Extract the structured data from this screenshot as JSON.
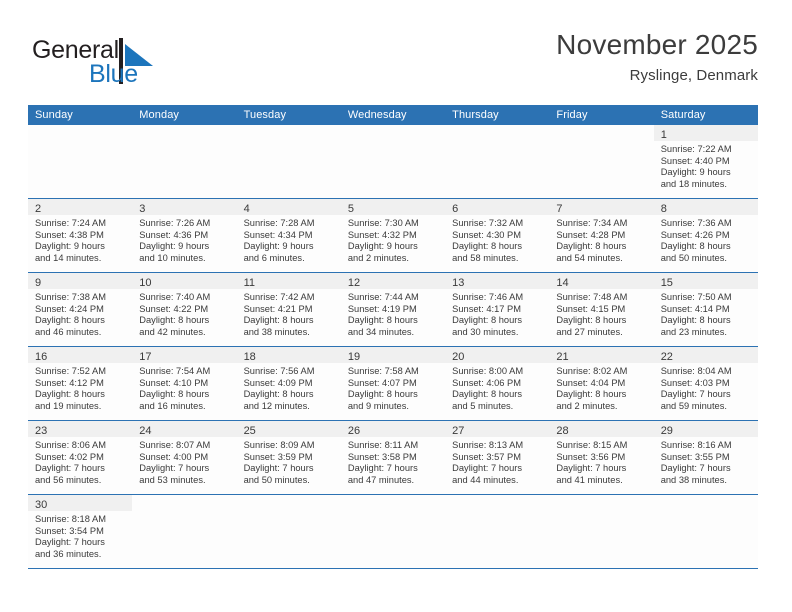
{
  "logo": {
    "word_one": "General",
    "word_two": "Blue",
    "mark": "triangle-mark",
    "color_dark": "#231f20",
    "color_blue": "#1c75bc"
  },
  "header": {
    "title": "November 2025",
    "subtitle": "Ryslinge, Denmark"
  },
  "theme": {
    "header_blue": "#2c72b3",
    "daynum_band": "#f0f0f0",
    "text": "#3a3a3a"
  },
  "weekdays": [
    "Sunday",
    "Monday",
    "Tuesday",
    "Wednesday",
    "Thursday",
    "Friday",
    "Saturday"
  ],
  "weeks": [
    [
      {
        "day": "",
        "lines": []
      },
      {
        "day": "",
        "lines": []
      },
      {
        "day": "",
        "lines": []
      },
      {
        "day": "",
        "lines": []
      },
      {
        "day": "",
        "lines": []
      },
      {
        "day": "",
        "lines": []
      },
      {
        "day": "1",
        "lines": [
          "Sunrise: 7:22 AM",
          "Sunset: 4:40 PM",
          "Daylight: 9 hours",
          "and 18 minutes."
        ]
      }
    ],
    [
      {
        "day": "2",
        "lines": [
          "Sunrise: 7:24 AM",
          "Sunset: 4:38 PM",
          "Daylight: 9 hours",
          "and 14 minutes."
        ]
      },
      {
        "day": "3",
        "lines": [
          "Sunrise: 7:26 AM",
          "Sunset: 4:36 PM",
          "Daylight: 9 hours",
          "and 10 minutes."
        ]
      },
      {
        "day": "4",
        "lines": [
          "Sunrise: 7:28 AM",
          "Sunset: 4:34 PM",
          "Daylight: 9 hours",
          "and 6 minutes."
        ]
      },
      {
        "day": "5",
        "lines": [
          "Sunrise: 7:30 AM",
          "Sunset: 4:32 PM",
          "Daylight: 9 hours",
          "and 2 minutes."
        ]
      },
      {
        "day": "6",
        "lines": [
          "Sunrise: 7:32 AM",
          "Sunset: 4:30 PM",
          "Daylight: 8 hours",
          "and 58 minutes."
        ]
      },
      {
        "day": "7",
        "lines": [
          "Sunrise: 7:34 AM",
          "Sunset: 4:28 PM",
          "Daylight: 8 hours",
          "and 54 minutes."
        ]
      },
      {
        "day": "8",
        "lines": [
          "Sunrise: 7:36 AM",
          "Sunset: 4:26 PM",
          "Daylight: 8 hours",
          "and 50 minutes."
        ]
      }
    ],
    [
      {
        "day": "9",
        "lines": [
          "Sunrise: 7:38 AM",
          "Sunset: 4:24 PM",
          "Daylight: 8 hours",
          "and 46 minutes."
        ]
      },
      {
        "day": "10",
        "lines": [
          "Sunrise: 7:40 AM",
          "Sunset: 4:22 PM",
          "Daylight: 8 hours",
          "and 42 minutes."
        ]
      },
      {
        "day": "11",
        "lines": [
          "Sunrise: 7:42 AM",
          "Sunset: 4:21 PM",
          "Daylight: 8 hours",
          "and 38 minutes."
        ]
      },
      {
        "day": "12",
        "lines": [
          "Sunrise: 7:44 AM",
          "Sunset: 4:19 PM",
          "Daylight: 8 hours",
          "and 34 minutes."
        ]
      },
      {
        "day": "13",
        "lines": [
          "Sunrise: 7:46 AM",
          "Sunset: 4:17 PM",
          "Daylight: 8 hours",
          "and 30 minutes."
        ]
      },
      {
        "day": "14",
        "lines": [
          "Sunrise: 7:48 AM",
          "Sunset: 4:15 PM",
          "Daylight: 8 hours",
          "and 27 minutes."
        ]
      },
      {
        "day": "15",
        "lines": [
          "Sunrise: 7:50 AM",
          "Sunset: 4:14 PM",
          "Daylight: 8 hours",
          "and 23 minutes."
        ]
      }
    ],
    [
      {
        "day": "16",
        "lines": [
          "Sunrise: 7:52 AM",
          "Sunset: 4:12 PM",
          "Daylight: 8 hours",
          "and 19 minutes."
        ]
      },
      {
        "day": "17",
        "lines": [
          "Sunrise: 7:54 AM",
          "Sunset: 4:10 PM",
          "Daylight: 8 hours",
          "and 16 minutes."
        ]
      },
      {
        "day": "18",
        "lines": [
          "Sunrise: 7:56 AM",
          "Sunset: 4:09 PM",
          "Daylight: 8 hours",
          "and 12 minutes."
        ]
      },
      {
        "day": "19",
        "lines": [
          "Sunrise: 7:58 AM",
          "Sunset: 4:07 PM",
          "Daylight: 8 hours",
          "and 9 minutes."
        ]
      },
      {
        "day": "20",
        "lines": [
          "Sunrise: 8:00 AM",
          "Sunset: 4:06 PM",
          "Daylight: 8 hours",
          "and 5 minutes."
        ]
      },
      {
        "day": "21",
        "lines": [
          "Sunrise: 8:02 AM",
          "Sunset: 4:04 PM",
          "Daylight: 8 hours",
          "and 2 minutes."
        ]
      },
      {
        "day": "22",
        "lines": [
          "Sunrise: 8:04 AM",
          "Sunset: 4:03 PM",
          "Daylight: 7 hours",
          "and 59 minutes."
        ]
      }
    ],
    [
      {
        "day": "23",
        "lines": [
          "Sunrise: 8:06 AM",
          "Sunset: 4:02 PM",
          "Daylight: 7 hours",
          "and 56 minutes."
        ]
      },
      {
        "day": "24",
        "lines": [
          "Sunrise: 8:07 AM",
          "Sunset: 4:00 PM",
          "Daylight: 7 hours",
          "and 53 minutes."
        ]
      },
      {
        "day": "25",
        "lines": [
          "Sunrise: 8:09 AM",
          "Sunset: 3:59 PM",
          "Daylight: 7 hours",
          "and 50 minutes."
        ]
      },
      {
        "day": "26",
        "lines": [
          "Sunrise: 8:11 AM",
          "Sunset: 3:58 PM",
          "Daylight: 7 hours",
          "and 47 minutes."
        ]
      },
      {
        "day": "27",
        "lines": [
          "Sunrise: 8:13 AM",
          "Sunset: 3:57 PM",
          "Daylight: 7 hours",
          "and 44 minutes."
        ]
      },
      {
        "day": "28",
        "lines": [
          "Sunrise: 8:15 AM",
          "Sunset: 3:56 PM",
          "Daylight: 7 hours",
          "and 41 minutes."
        ]
      },
      {
        "day": "29",
        "lines": [
          "Sunrise: 8:16 AM",
          "Sunset: 3:55 PM",
          "Daylight: 7 hours",
          "and 38 minutes."
        ]
      }
    ],
    [
      {
        "day": "30",
        "lines": [
          "Sunrise: 8:18 AM",
          "Sunset: 3:54 PM",
          "Daylight: 7 hours",
          "and 36 minutes."
        ]
      },
      {
        "day": "",
        "lines": []
      },
      {
        "day": "",
        "lines": []
      },
      {
        "day": "",
        "lines": []
      },
      {
        "day": "",
        "lines": []
      },
      {
        "day": "",
        "lines": []
      },
      {
        "day": "",
        "lines": []
      }
    ]
  ]
}
